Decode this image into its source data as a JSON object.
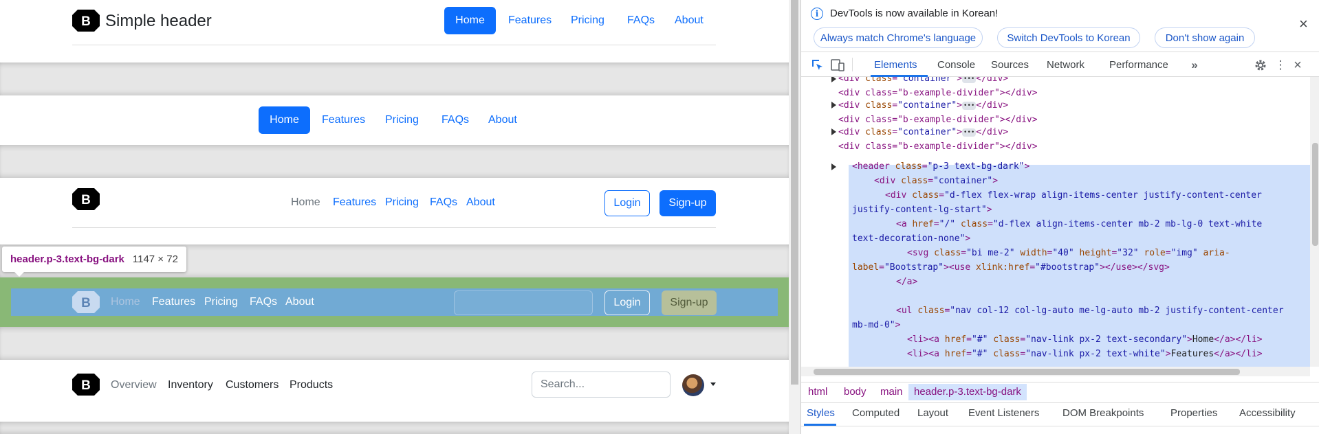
{
  "section1": {
    "brand": "Simple header",
    "nav": [
      "Home",
      "Features",
      "Pricing",
      "FAQs",
      "About"
    ]
  },
  "section2": {
    "nav": [
      "Home",
      "Features",
      "Pricing",
      "FAQs",
      "About"
    ]
  },
  "section3": {
    "nav": [
      "Home",
      "Features",
      "Pricing",
      "FAQs",
      "About"
    ],
    "login": "Login",
    "signup": "Sign-up"
  },
  "section4": {
    "nav": [
      "Home",
      "Features",
      "Pricing",
      "FAQs",
      "About"
    ],
    "login": "Login",
    "signup": "Sign-up"
  },
  "section5": {
    "nav": [
      "Overview",
      "Inventory",
      "Customers",
      "Products"
    ],
    "search_placeholder": "Search..."
  },
  "inspector_tooltip": {
    "selector": "header.p-3.text-bg-dark",
    "size": "1147 × 72"
  },
  "devtools": {
    "infobar": {
      "message": "DevTools is now available in Korean!",
      "buttons": [
        "Always match Chrome's language",
        "Switch DevTools to Korean",
        "Don't show again"
      ]
    },
    "tabs": [
      "Elements",
      "Console",
      "Sources",
      "Network",
      "Performance"
    ],
    "active_tab": "Elements",
    "breadcrumbs": [
      "html",
      "body",
      "main",
      "header.p-3.text-bg-dark"
    ],
    "subtabs": [
      "Styles",
      "Computed",
      "Layout",
      "Event Listeners",
      "DOM Breakpoints",
      "Properties",
      "Accessibility"
    ],
    "active_subtab": "Styles",
    "code": {
      "l1_tag": "<div ",
      "l1_attr": "class",
      "l1_val": "\"container\"",
      "l1_close": "</div>",
      "l2": "<div class=\"b-example-divider\"></div>",
      "l3_tag": "<div ",
      "l3_attr": "class",
      "l3_val": "\"container\"",
      "l3_close": "</div>",
      "l4": "<div class=\"b-example-divider\"></div>",
      "l5_tag": "<div ",
      "l5_attr": "class",
      "l5_val": "\"container\"",
      "l5_close": "</div>",
      "l6": "<div class=\"b-example-divider\"></div>",
      "l7_tag": "<header ",
      "l7_attr": "class",
      "l7_val": "\"p-3 text-bg-dark\"",
      "l8_tag": "<div ",
      "l8_attr": "class",
      "l8_val": "\"container\"",
      "l9_tag": "<div ",
      "l9_attr": "class",
      "l9_val": "\"d-flex flex-wrap align-items-center justify-content-center",
      "l10_val": "justify-content-lg-start\"",
      "l11_tag": "<a ",
      "l11_attr1": "href",
      "l11_val1": "\"/\"",
      "l11_attr2": "class",
      "l11_val2": "\"d-flex align-items-center mb-2 mb-lg-0 text-white",
      "l12_val": "text-decoration-none\"",
      "l13_tag": "<svg ",
      "l13_attr1": "class",
      "l13_val1": "\"bi me-2\"",
      "l13_attr2": "width",
      "l13_val2": "\"40\"",
      "l13_attr3": "height",
      "l13_val3": "\"32\"",
      "l13_attr4": "role",
      "l13_val4": "\"img\"",
      "l13_attr5": "aria-",
      "l14_attr": "label",
      "l14_val": "\"Bootstrap\"",
      "l14_use": "<use ",
      "l14_attr2": "xlink:href",
      "l14_val2": "\"#bootstrap\"",
      "l14_rest": "></use></svg>",
      "l15": "</a>",
      "l16_tag": "<ul ",
      "l16_attr": "class",
      "l16_val": "\"nav col-12 col-lg-auto me-lg-auto mb-2 justify-content-center",
      "l17_val": "mb-md-0\"",
      "l18_pre": "<li><a ",
      "l18_attr1": "href",
      "l18_val1": "\"#\"",
      "l18_attr2": "class",
      "l18_val2": "\"nav-link px-2 text-secondary\"",
      "l18_text": "Home",
      "l18_close": "</a></li>",
      "l19_pre": "<li><a ",
      "l19_attr1": "href",
      "l19_val1": "\"#\"",
      "l19_attr2": "class",
      "l19_val2": "\"nav-link px-2 text-white\"",
      "l19_text": "Features",
      "l19_close": "</a></li>"
    }
  },
  "colors": {
    "primary": "#0d6efd",
    "overlay_margin": "#93c47d",
    "overlay_content": "#6fa8dc",
    "devtools_accent": "#1a73e8"
  }
}
